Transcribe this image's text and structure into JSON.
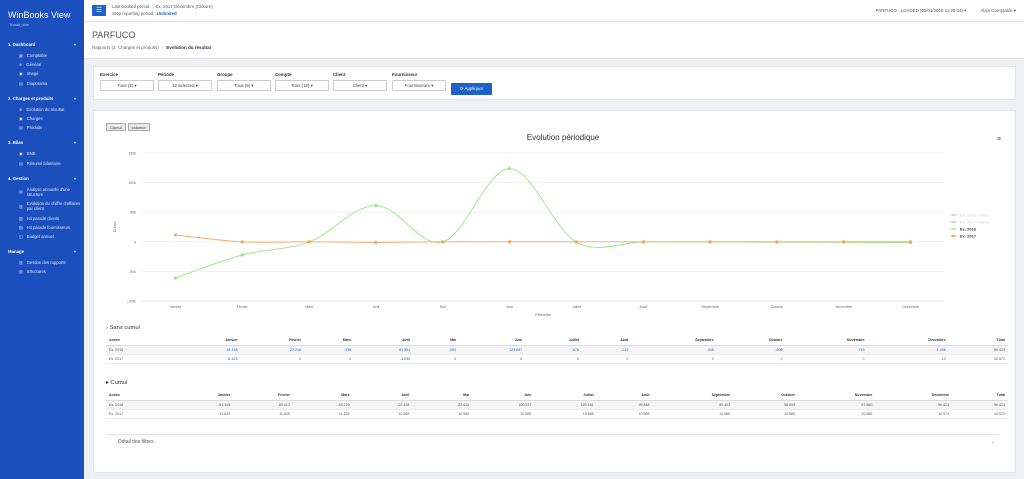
{
  "app": {
    "title": "WinBooks View",
    "subtitle": "Trustit_Win"
  },
  "sidebar": {
    "sections": [
      {
        "label": "1. Dashboard",
        "items": [
          "Comptable",
          "Général",
          "Imagé",
          "Diaporama"
        ]
      },
      {
        "label": "2. Charges et produits",
        "items": [
          "Evolution du résultat",
          "Charges",
          "Produits"
        ]
      },
      {
        "label": "3. Bilan",
        "items": [
          "BNB",
          "Résumé bilantaire"
        ]
      },
      {
        "label": "4. Gestion",
        "items": [
          "Analyse annuelle d'une structure",
          "Evolution du chiffre d'affaires par client",
          "Hit parade clients",
          "Hit parade fournisseurs",
          "Budget annuel"
        ]
      },
      {
        "label": "Manage",
        "items": [
          "Gestion des rapports",
          "Structures"
        ]
      }
    ]
  },
  "topbar": {
    "last_period_label": "Last booked period",
    "last_period_value": ": Ex. 2017 Décembre (Clôture)",
    "stop_label": "Stop reporting period :",
    "stop_value": "Unlimited",
    "company": "PARFUCO - LOADED (05/01/2018 11:28:04)",
    "user": "Alain Comptable"
  },
  "header": {
    "title": "PARFUCO",
    "breadcrumb": [
      "Rapports (2. Charges et produits)",
      "Evolution du résultat"
    ]
  },
  "filters": [
    {
      "label": "Exercice",
      "value": "Tous (2)"
    },
    {
      "label": "Période",
      "value": "12 selected"
    },
    {
      "label": "Groupe",
      "value": "Tous (6)"
    },
    {
      "label": "Compte",
      "value": "Tous (18)"
    },
    {
      "label": "Client",
      "value": "Client"
    },
    {
      "label": "Fournisseur",
      "value": "Fournisseurs"
    }
  ],
  "apply_label": "Appliquer",
  "toggles": [
    "Cumul",
    "colonne"
  ],
  "chart_data": {
    "type": "line",
    "title": "Evolution périodique",
    "xlabel": "Périodes",
    "ylabel": "Euros",
    "categories": [
      "Janvier",
      "Février",
      "Mars",
      "Avril",
      "Mai",
      "Juin",
      "Juillet",
      "Août",
      "Septembre",
      "Octobre",
      "Novembre",
      "Décembre"
    ],
    "y_ticks": [
      "150k",
      "100k",
      "50k",
      "0",
      "-50k",
      "-100k"
    ],
    "ylim": [
      -100000,
      150000
    ],
    "legend_position": "right",
    "series": [
      {
        "name": "Ex. 2016 Cumul",
        "color": "#cccccc",
        "hidden": true,
        "values": []
      },
      {
        "name": "Ex. 2017 Cumul",
        "color": "#cccccc",
        "hidden": true,
        "values": []
      },
      {
        "name": "Ex. 2016",
        "color": "#90ed7d",
        "values": [
          -61195,
          -22218,
          -316,
          61381,
          -283,
          123647,
          -676,
          -212,
          -445,
          -608,
          -743,
          -1436
        ]
      },
      {
        "name": "Ex. 2017",
        "color": "#f7a35c",
        "values": [
          11625,
          0,
          0,
          -1040,
          0,
          0,
          0,
          0,
          0,
          0,
          0,
          -13
        ]
      }
    ]
  },
  "sans_cumul": {
    "title": "Sans cumul",
    "headers": [
      "Année",
      "Janvier",
      "Février",
      "Mars",
      "Avril",
      "Mai",
      "Juin",
      "Juillet",
      "Août",
      "Septembre",
      "Octobre",
      "Novembre",
      "Décembre",
      "Total"
    ],
    "rows": [
      [
        "Ex. 2016",
        "-61.195",
        "-22.218",
        "-316",
        "61.381",
        "-283",
        "123.647",
        "-676",
        "-212",
        "-445",
        "-608",
        "-743",
        "-1.436",
        "96.423"
      ],
      [
        "Ex. 2017",
        "11.625",
        "0",
        "0",
        "-1.040",
        "0",
        "0",
        "0",
        "0",
        "0",
        "0",
        "0",
        "-13",
        "10.572"
      ]
    ]
  },
  "cumul": {
    "title": "Cumul",
    "headers": [
      "Année",
      "Janvier",
      "Février",
      "Mars",
      "Avril",
      "Mai",
      "Juin",
      "Juillet",
      "Août",
      "Septembre",
      "Octobre",
      "Novembre",
      "Décembre",
      "Total"
    ],
    "rows": [
      [
        "Ex. 2016",
        "-61.195",
        "-83.413",
        "-83.729",
        "-22.428",
        "-22.410",
        "100.937",
        "100.161",
        "99.848",
        "99.403",
        "98.693",
        "97.860",
        "96.423",
        "96.423"
      ],
      [
        "Ex. 2017",
        "11.625",
        "11.625",
        "11.625",
        "10.585",
        "10.585",
        "10.585",
        "10.585",
        "10.585",
        "10.585",
        "10.585",
        "10.585",
        "10.572",
        "10.572"
      ]
    ]
  },
  "details_label": "Détail des filtres"
}
